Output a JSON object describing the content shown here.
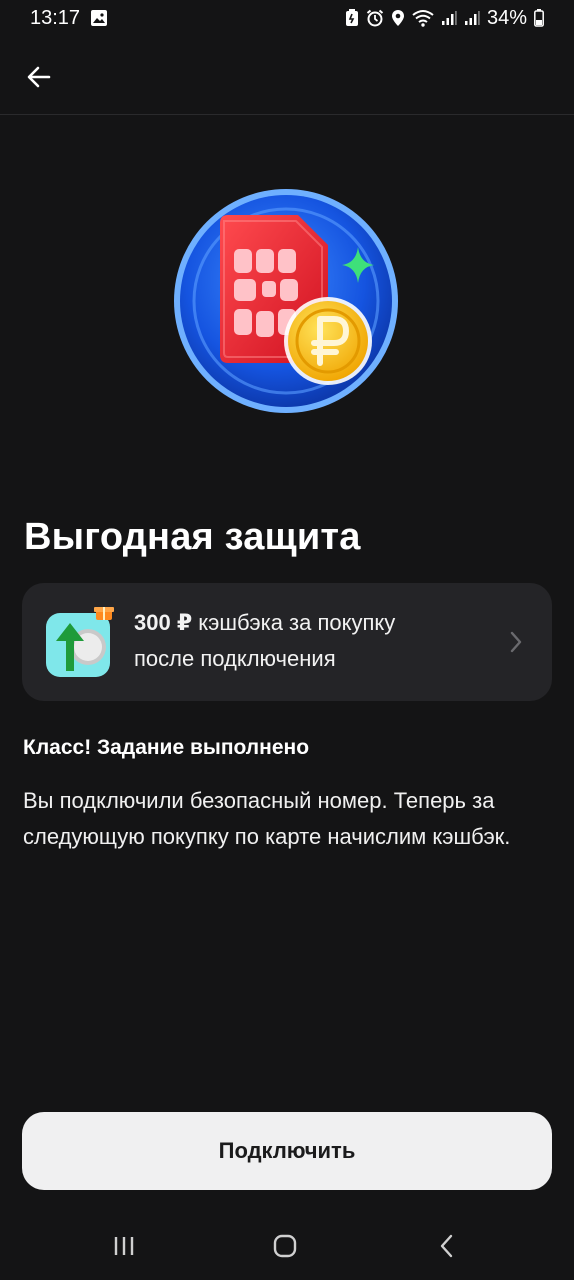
{
  "status_bar": {
    "time": "13:17",
    "battery": "34%",
    "icons": [
      "gallery-icon",
      "battery-saver-icon",
      "alarm-icon",
      "location-icon",
      "wifi-icon",
      "signal-icon",
      "signal-icon",
      "battery-icon"
    ]
  },
  "header": {
    "back_icon": "arrow-left-icon"
  },
  "hero": {
    "image": "sim-card-coin-illustration"
  },
  "page": {
    "title": "Выгодная защита"
  },
  "cashback_card": {
    "amount": "300 ₽",
    "text_line1": " кэшбэка за покупку",
    "text_line2": "после подключения",
    "icon": "cashback-arrow-icon",
    "chevron": "chevron-right-icon"
  },
  "status": {
    "heading": "Класс! Задание выполнено",
    "description": "Вы подключили безопасный номер. Теперь за следующую покупку по карте начислим кэшбэк."
  },
  "action": {
    "connect_label": "Подключить"
  },
  "nav": {
    "items": [
      "recent-apps-icon",
      "home-icon",
      "back-icon"
    ]
  },
  "colors": {
    "background": "#141415",
    "card": "#242427",
    "button": "#f0f0f1",
    "accent_blue": "#1e5fe8",
    "sim_red": "#e8222e",
    "coin_gold": "#f5b800"
  }
}
